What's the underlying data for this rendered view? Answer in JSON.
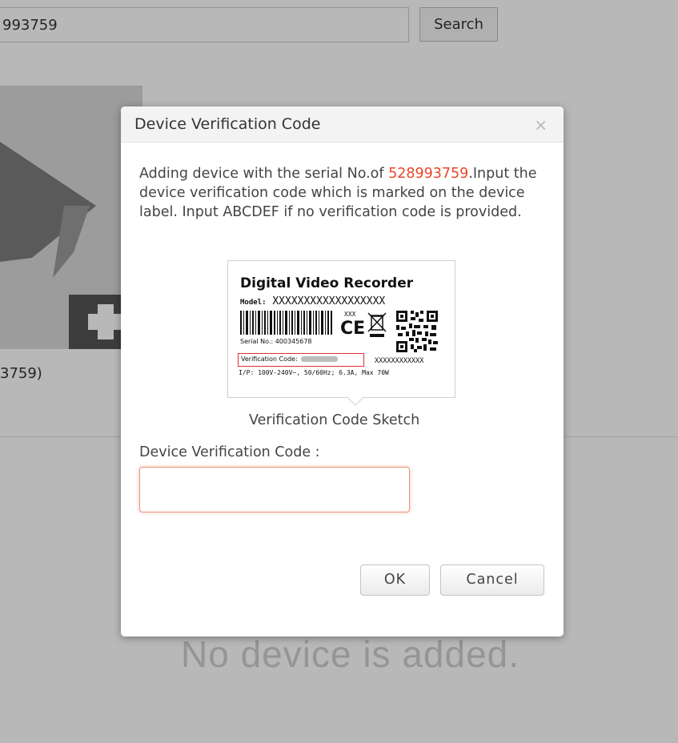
{
  "search": {
    "value": "993759",
    "button_label": "Search"
  },
  "device_card": {
    "caption": "3759)"
  },
  "empty_state": {
    "message": "No device is added."
  },
  "modal": {
    "title": "Device Verification Code",
    "close_glyph": "×",
    "message_prefix": "Adding device with the serial No.of ",
    "serial_number": "528993759",
    "message_suffix": ".Input the device verification code which is marked on the device label. Input ABCDEF if no verification code is provided.",
    "sketch": {
      "title": "Digital Video Recorder",
      "model_key": "Model:",
      "model_value": "XXXXXXXXXXXXXXXXXX",
      "xxx": "XXX",
      "ce": "CE",
      "serial_text": "Serial No.:  400345678",
      "verification_text": "Verification Code:",
      "x_code": "XXXXXXXXXXXX",
      "power_text": "I/P: 100V-240V~, 50/60Hz;  6.3A,  Max 70W",
      "caption": "Verification Code Sketch"
    },
    "field_label": "Device Verification Code :",
    "input_value": "",
    "ok_label": "OK",
    "cancel_label": "Cancel"
  },
  "colors": {
    "serial_highlight": "#e8462a",
    "overlay": "rgba(0,0,0,0.28)",
    "input_focus_border": "#e89a7c"
  }
}
